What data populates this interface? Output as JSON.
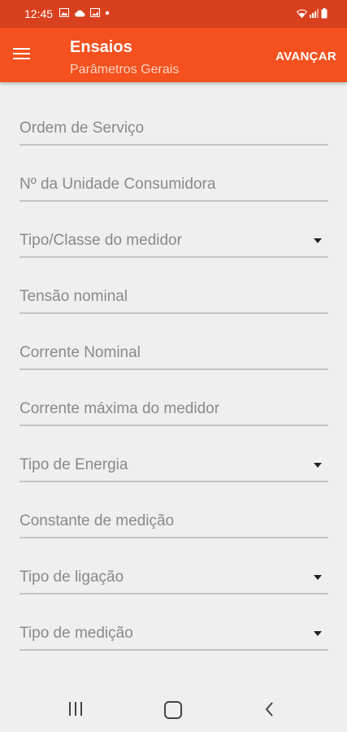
{
  "status_bar": {
    "time": "12:45",
    "bg_color": "#d9411e"
  },
  "app_bar": {
    "title": "Ensaios",
    "subtitle": "Parâmetros Gerais",
    "next_label": "AVANÇAR",
    "bg_color": "#f4511e"
  },
  "form": {
    "fields": [
      {
        "label": "Ordem de Serviço",
        "type": "text"
      },
      {
        "label": "Nº da Unidade Consumidora",
        "type": "text"
      },
      {
        "label": "Tipo/Classe do medidor",
        "type": "dropdown"
      },
      {
        "label": "Tensão nominal",
        "type": "text"
      },
      {
        "label": "Corrente Nominal",
        "type": "text"
      },
      {
        "label": "Corrente máxima do medidor",
        "type": "text"
      },
      {
        "label": "Tipo de Energia",
        "type": "dropdown"
      },
      {
        "label": "Constante de medição",
        "type": "text"
      },
      {
        "label": "Tipo de ligação",
        "type": "dropdown"
      },
      {
        "label": "Tipo de medição",
        "type": "dropdown"
      }
    ]
  }
}
